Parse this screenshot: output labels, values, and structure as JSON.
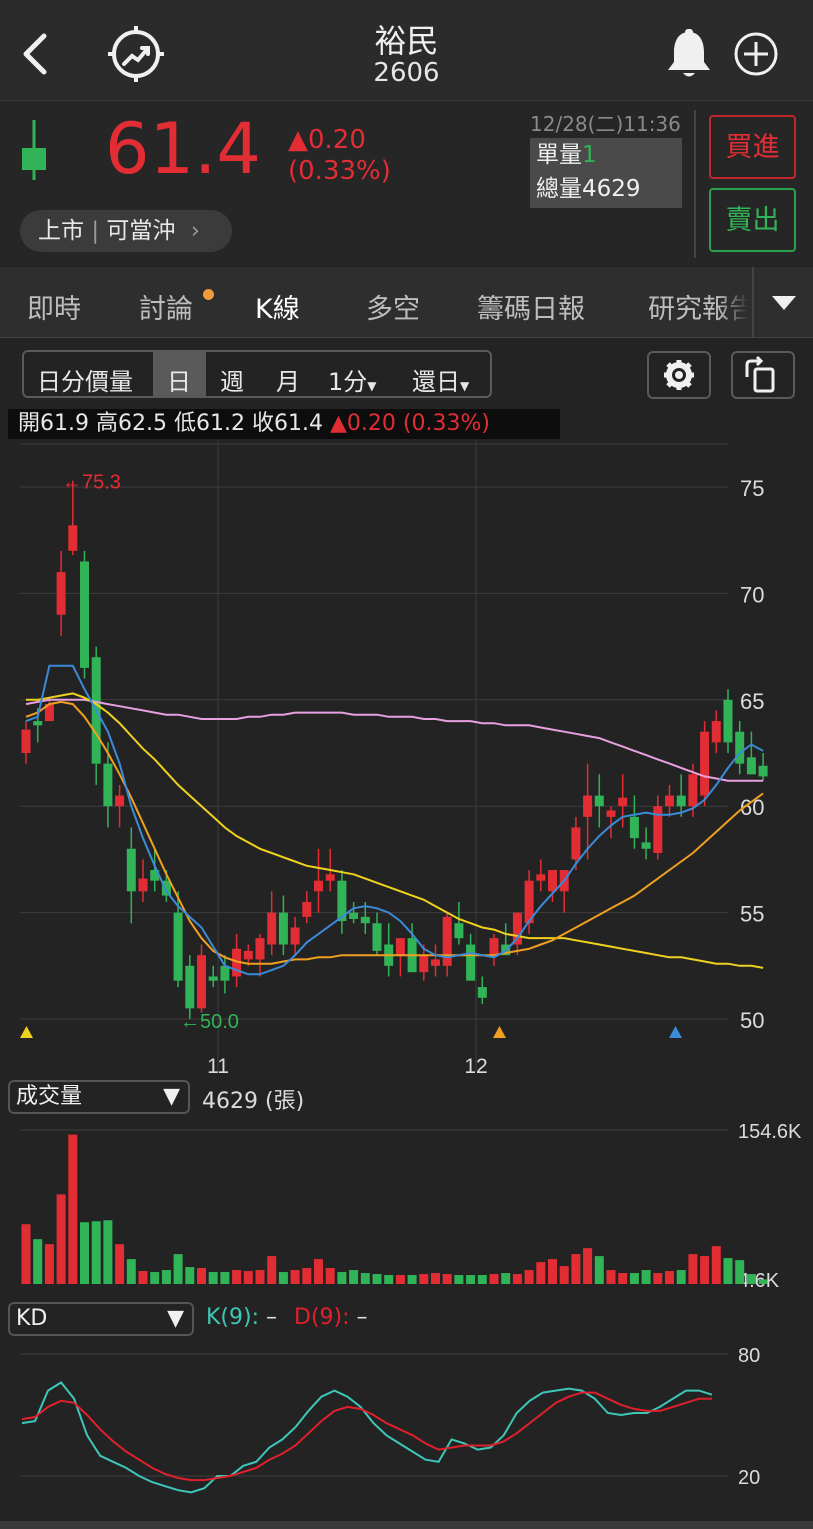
{
  "header": {
    "title": "裕民",
    "code": "2606",
    "back_icon": "chevron-left-icon",
    "chart_icon": "trend-target-icon",
    "bell_icon": "bell-icon",
    "add_icon": "plus-circle-icon"
  },
  "quote": {
    "price": "61.4",
    "change": "▲0.20",
    "change_pct": "(0.33%)",
    "market_tag": "上市",
    "daytrade_tag": "可當沖",
    "datetime": "12/28(二)11:36",
    "single_vol_label": "單量",
    "single_vol_value": "1",
    "total_vol_label": "總量",
    "total_vol_value": "4629",
    "buy_label": "買進",
    "sell_label": "賣出"
  },
  "tabs": [
    "即時",
    "討論",
    "K線",
    "多空",
    "籌碼日報",
    "研究報告"
  ],
  "active_tab": "K線",
  "period_selector": {
    "items": [
      "日分價量",
      "日",
      "週",
      "月",
      "1分",
      "還日"
    ],
    "active": "日"
  },
  "ohlc": {
    "open_label": "開",
    "open": "61.9",
    "high_label": "高",
    "high": "62.5",
    "low_label": "低",
    "low": "61.2",
    "close_label": "收",
    "close": "61.4",
    "change": "▲0.20 (0.33%)"
  },
  "price_chart": {
    "y_ticks": [
      "75",
      "70",
      "65",
      "60",
      "55",
      "50"
    ],
    "x_ticks": [
      "11",
      "12"
    ],
    "high_marker": "←75.3",
    "low_marker": "←50.0"
  },
  "volume_panel": {
    "select_label": "成交量",
    "value_text": "4629 (張)",
    "y_max": "154.6K",
    "y_min": "4.6K"
  },
  "kd_panel": {
    "select_label": "KD",
    "k_label": "K(9):",
    "k_value": "–",
    "d_label": "D(9):",
    "d_value": "–",
    "y_high": "80",
    "y_low": "20"
  },
  "colors": {
    "up": "#e32d34",
    "down": "#31b457",
    "ma5": "#3a8bd8",
    "ma10": "#f0d21e",
    "ma20": "#f0a020",
    "ma60": "#e8a0e0",
    "k_line": "#3ec7b8",
    "d_line": "#e0202c"
  },
  "chart_data": {
    "type": "candlestick",
    "ylim": [
      50,
      75
    ],
    "x_ticks": [
      "11",
      "12"
    ],
    "ohlc": [
      [
        62.5,
        64.0,
        62.0,
        63.6
      ],
      [
        64.0,
        64.6,
        63.0,
        63.8
      ],
      [
        64.0,
        65.0,
        64.0,
        64.8
      ],
      [
        69.0,
        72.0,
        68.0,
        71.0
      ],
      [
        72.0,
        75.3,
        71.8,
        73.2
      ],
      [
        71.5,
        72.0,
        66.0,
        66.5
      ],
      [
        67.0,
        67.5,
        61.0,
        62.0
      ],
      [
        62.0,
        63.0,
        59.0,
        60.0
      ],
      [
        60.0,
        61.0,
        59.0,
        60.5
      ],
      [
        58.0,
        59.0,
        54.5,
        56.0
      ],
      [
        56.0,
        57.5,
        55.5,
        56.6
      ],
      [
        57.0,
        58.0,
        56.0,
        56.5
      ],
      [
        56.5,
        57.0,
        55.5,
        55.8
      ],
      [
        55.0,
        56.0,
        51.5,
        51.8
      ],
      [
        52.5,
        53.0,
        50.0,
        50.5
      ],
      [
        50.5,
        53.5,
        50.3,
        53.0
      ],
      [
        52.0,
        52.5,
        51.5,
        51.8
      ],
      [
        52.5,
        53.0,
        51.2,
        51.8
      ],
      [
        52.0,
        54.0,
        51.5,
        53.3
      ],
      [
        52.8,
        53.5,
        52.5,
        53.2
      ],
      [
        52.8,
        54.0,
        52.0,
        53.8
      ],
      [
        53.5,
        56.0,
        53.0,
        55.0
      ],
      [
        55.0,
        55.8,
        53.0,
        53.5
      ],
      [
        53.5,
        54.8,
        53.0,
        54.3
      ],
      [
        54.8,
        56.0,
        54.5,
        55.5
      ],
      [
        56.0,
        58.0,
        55.0,
        56.5
      ],
      [
        56.5,
        58.0,
        56.0,
        56.8
      ],
      [
        56.5,
        57.0,
        54.0,
        54.6
      ],
      [
        55.0,
        55.5,
        54.5,
        54.7
      ],
      [
        54.8,
        55.5,
        54.0,
        54.5
      ],
      [
        54.5,
        55.0,
        53.0,
        53.2
      ],
      [
        53.5,
        54.5,
        52.0,
        52.5
      ],
      [
        53.0,
        53.5,
        52.0,
        53.8
      ],
      [
        53.8,
        54.5,
        52.2,
        52.2
      ],
      [
        52.2,
        53.5,
        51.8,
        53.0
      ],
      [
        52.5,
        53.5,
        52.0,
        52.8
      ],
      [
        52.5,
        55.0,
        52.0,
        54.8
      ],
      [
        54.5,
        55.5,
        53.5,
        53.8
      ],
      [
        53.5,
        54.0,
        52.0,
        51.8
      ],
      [
        51.5,
        52.0,
        50.7,
        51.0
      ],
      [
        53.0,
        54.0,
        52.5,
        53.8
      ],
      [
        53.5,
        54.5,
        53.0,
        53.0
      ],
      [
        53.5,
        55.0,
        53.0,
        55.0
      ],
      [
        54.5,
        57.0,
        54.0,
        56.5
      ],
      [
        56.5,
        57.5,
        56.0,
        56.8
      ],
      [
        56.0,
        57.0,
        55.5,
        57.0
      ],
      [
        56.0,
        57.0,
        55.0,
        57.0
      ],
      [
        57.5,
        59.5,
        57.0,
        59.0
      ],
      [
        59.5,
        62.0,
        57.5,
        60.5
      ],
      [
        60.5,
        61.5,
        59.0,
        60.0
      ],
      [
        59.5,
        60.0,
        58.5,
        59.8
      ],
      [
        60.0,
        61.5,
        59.0,
        60.4
      ],
      [
        59.5,
        60.5,
        58.0,
        58.5
      ],
      [
        58.3,
        59.0,
        57.5,
        58.0
      ],
      [
        57.8,
        60.5,
        57.5,
        60.0
      ],
      [
        60.0,
        61.0,
        59.5,
        60.5
      ],
      [
        60.5,
        61.5,
        59.5,
        60.0
      ],
      [
        60.0,
        62.0,
        59.5,
        61.5
      ],
      [
        60.5,
        64.0,
        60.0,
        63.5
      ],
      [
        63.0,
        64.5,
        62.5,
        64.0
      ],
      [
        65.0,
        65.5,
        62.5,
        63.0
      ],
      [
        63.5,
        64.0,
        61.5,
        62.0
      ],
      [
        62.3,
        63.5,
        61.5,
        61.5
      ],
      [
        61.9,
        62.5,
        61.2,
        61.4
      ]
    ],
    "ma5": [
      64,
      64.2,
      66.6,
      66.6,
      66.6,
      65.5,
      64.5,
      63.5,
      62.0,
      60.0,
      58.5,
      57.2,
      56.0,
      55.3,
      54.8,
      54.3,
      53.4,
      52.5,
      52.3,
      52.1,
      52.1,
      52.3,
      52.5,
      53.0,
      53.6,
      54.0,
      54.4,
      54.8,
      55.2,
      55.3,
      55.2,
      55.0,
      54.6,
      54.0,
      53.3,
      53.0,
      52.9,
      53.0,
      53.1,
      53.0,
      52.9,
      53.2,
      53.8,
      54.6,
      55.3,
      55.9,
      56.5,
      57.3,
      58.0,
      58.6,
      59.1,
      59.5,
      59.6,
      59.7,
      59.6,
      59.6,
      59.7,
      59.9,
      60.3,
      61.0,
      61.8,
      62.5,
      62.9,
      62.6
    ],
    "ma10": [
      65.0,
      65.0,
      65.1,
      65.2,
      65.3,
      65.1,
      64.8,
      64.4,
      63.9,
      63.3,
      62.7,
      62.2,
      61.6,
      61.0,
      60.5,
      60.0,
      59.5,
      59.0,
      58.6,
      58.3,
      58.0,
      57.8,
      57.6,
      57.4,
      57.2,
      57.1,
      57.0,
      56.9,
      56.8,
      56.6,
      56.4,
      56.2,
      56.0,
      55.8,
      55.6,
      55.3,
      55.0,
      54.7,
      54.5,
      54.3,
      54.2,
      54.0,
      53.9,
      53.8,
      53.8,
      53.8,
      53.8,
      53.7,
      53.6,
      53.5,
      53.4,
      53.3,
      53.2,
      53.1,
      53.0,
      52.9,
      52.9,
      52.8,
      52.7,
      52.6,
      52.6,
      52.5,
      52.5,
      52.4
    ],
    "ma20": [
      64.2,
      64.4,
      64.8,
      64.9,
      64.8,
      64.2,
      63.4,
      62.5,
      61.5,
      60.4,
      59.2,
      58.0,
      56.8,
      55.7,
      54.6,
      53.8,
      53.2,
      52.9,
      52.7,
      52.6,
      52.6,
      52.6,
      52.7,
      52.8,
      52.8,
      52.9,
      52.9,
      53.0,
      53.0,
      53.0,
      53.0,
      53.0,
      53.0,
      53.0,
      53.0,
      53.0,
      53.0,
      53.0,
      53.0,
      53.0,
      53.0,
      53.1,
      53.2,
      53.3,
      53.5,
      53.7,
      54.0,
      54.3,
      54.6,
      54.9,
      55.2,
      55.5,
      55.8,
      56.2,
      56.6,
      57.0,
      57.4,
      57.8,
      58.3,
      58.8,
      59.3,
      59.8,
      60.2,
      60.6
    ],
    "ma60": [
      64.8,
      64.9,
      65.0,
      65.0,
      65.0,
      65.0,
      64.9,
      64.8,
      64.7,
      64.6,
      64.5,
      64.4,
      64.3,
      64.3,
      64.2,
      64.1,
      64.1,
      64.1,
      64.1,
      64.2,
      64.2,
      64.3,
      64.3,
      64.4,
      64.4,
      64.4,
      64.4,
      64.4,
      64.3,
      64.3,
      64.3,
      64.2,
      64.2,
      64.2,
      64.1,
      64.1,
      64.0,
      64.0,
      64.0,
      63.9,
      63.9,
      63.8,
      63.8,
      63.8,
      63.7,
      63.6,
      63.5,
      63.4,
      63.3,
      63.2,
      63.0,
      62.8,
      62.6,
      62.4,
      62.2,
      62.0,
      61.8,
      61.6,
      61.4,
      61.3,
      61.2,
      61.2,
      61.2,
      61.2
    ],
    "volume": [
      60,
      45,
      40,
      90,
      150,
      62,
      63,
      64,
      40,
      25,
      13,
      12,
      14,
      30,
      17,
      16,
      12,
      12,
      14,
      13,
      14,
      28,
      12,
      14,
      16,
      25,
      16,
      12,
      14,
      11,
      10,
      9,
      9,
      9,
      10,
      11,
      10,
      9,
      9,
      9,
      10,
      11,
      10,
      14,
      22,
      25,
      18,
      30,
      36,
      28,
      14,
      11,
      11,
      14,
      11,
      13,
      14,
      30,
      28,
      38,
      26,
      24,
      10,
      4.6
    ],
    "k": [
      46,
      47,
      62,
      66,
      58,
      40,
      30,
      27,
      24,
      20,
      17,
      15,
      13,
      12,
      14,
      20,
      20,
      25,
      27,
      34,
      38,
      44,
      52,
      59,
      62,
      59,
      54,
      46,
      40,
      36,
      32,
      28,
      27,
      38,
      36,
      33,
      34,
      40,
      51,
      57,
      61,
      62,
      63,
      62,
      58,
      51,
      50,
      51,
      51,
      54,
      58,
      62,
      62,
      60
    ],
    "d": [
      48,
      49,
      54,
      57,
      56,
      50,
      43,
      37,
      32,
      28,
      24,
      21,
      19,
      18,
      18,
      19,
      20,
      22,
      24,
      28,
      31,
      35,
      41,
      47,
      52,
      54,
      53,
      50,
      46,
      43,
      40,
      36,
      33,
      34,
      35,
      35,
      35,
      37,
      41,
      46,
      51,
      56,
      59,
      61,
      61,
      58,
      55,
      53,
      52,
      52,
      54,
      56,
      58,
      58
    ]
  }
}
